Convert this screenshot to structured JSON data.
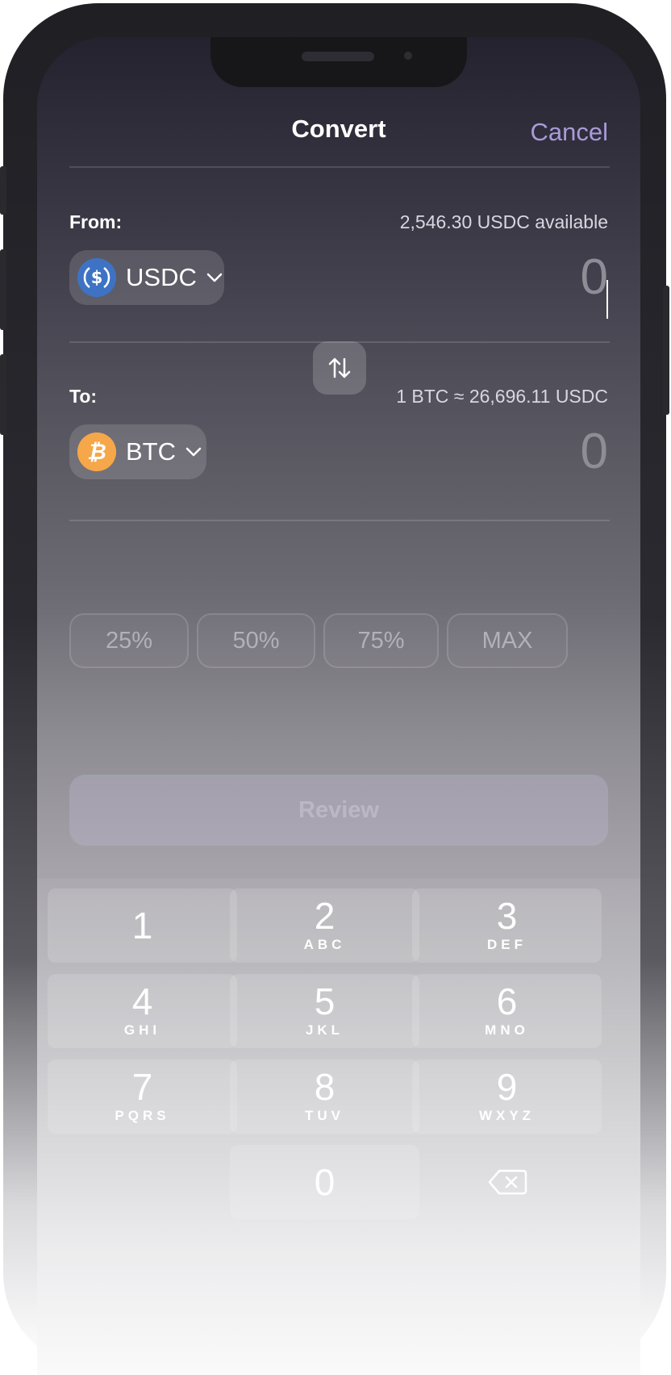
{
  "header": {
    "title": "Convert",
    "cancel_label": "Cancel"
  },
  "from": {
    "label": "From:",
    "available": "2,546.30 USDC available",
    "asset": "USDC",
    "asset_icon": "usdc-coin-icon",
    "amount": "0"
  },
  "to": {
    "label": "To:",
    "rate": "1 BTC ≈ 26,696.11 USDC",
    "asset": "BTC",
    "asset_icon": "btc-coin-icon",
    "amount": "0"
  },
  "percent_options": [
    "25%",
    "50%",
    "75%",
    "MAX"
  ],
  "review_label": "Review",
  "keypad": [
    {
      "num": "1",
      "letters": ""
    },
    {
      "num": "2",
      "letters": "ABC"
    },
    {
      "num": "3",
      "letters": "DEF"
    },
    {
      "num": "4",
      "letters": "GHI"
    },
    {
      "num": "5",
      "letters": "JKL"
    },
    {
      "num": "6",
      "letters": "MNO"
    },
    {
      "num": "7",
      "letters": "PQRS"
    },
    {
      "num": "8",
      "letters": "TUV"
    },
    {
      "num": "9",
      "letters": "WXYZ"
    },
    {
      "num": "0",
      "letters": ""
    }
  ],
  "colors": {
    "accent": "#a99bd9",
    "usdc": "#3e73c4",
    "btc": "#f5a74a"
  }
}
